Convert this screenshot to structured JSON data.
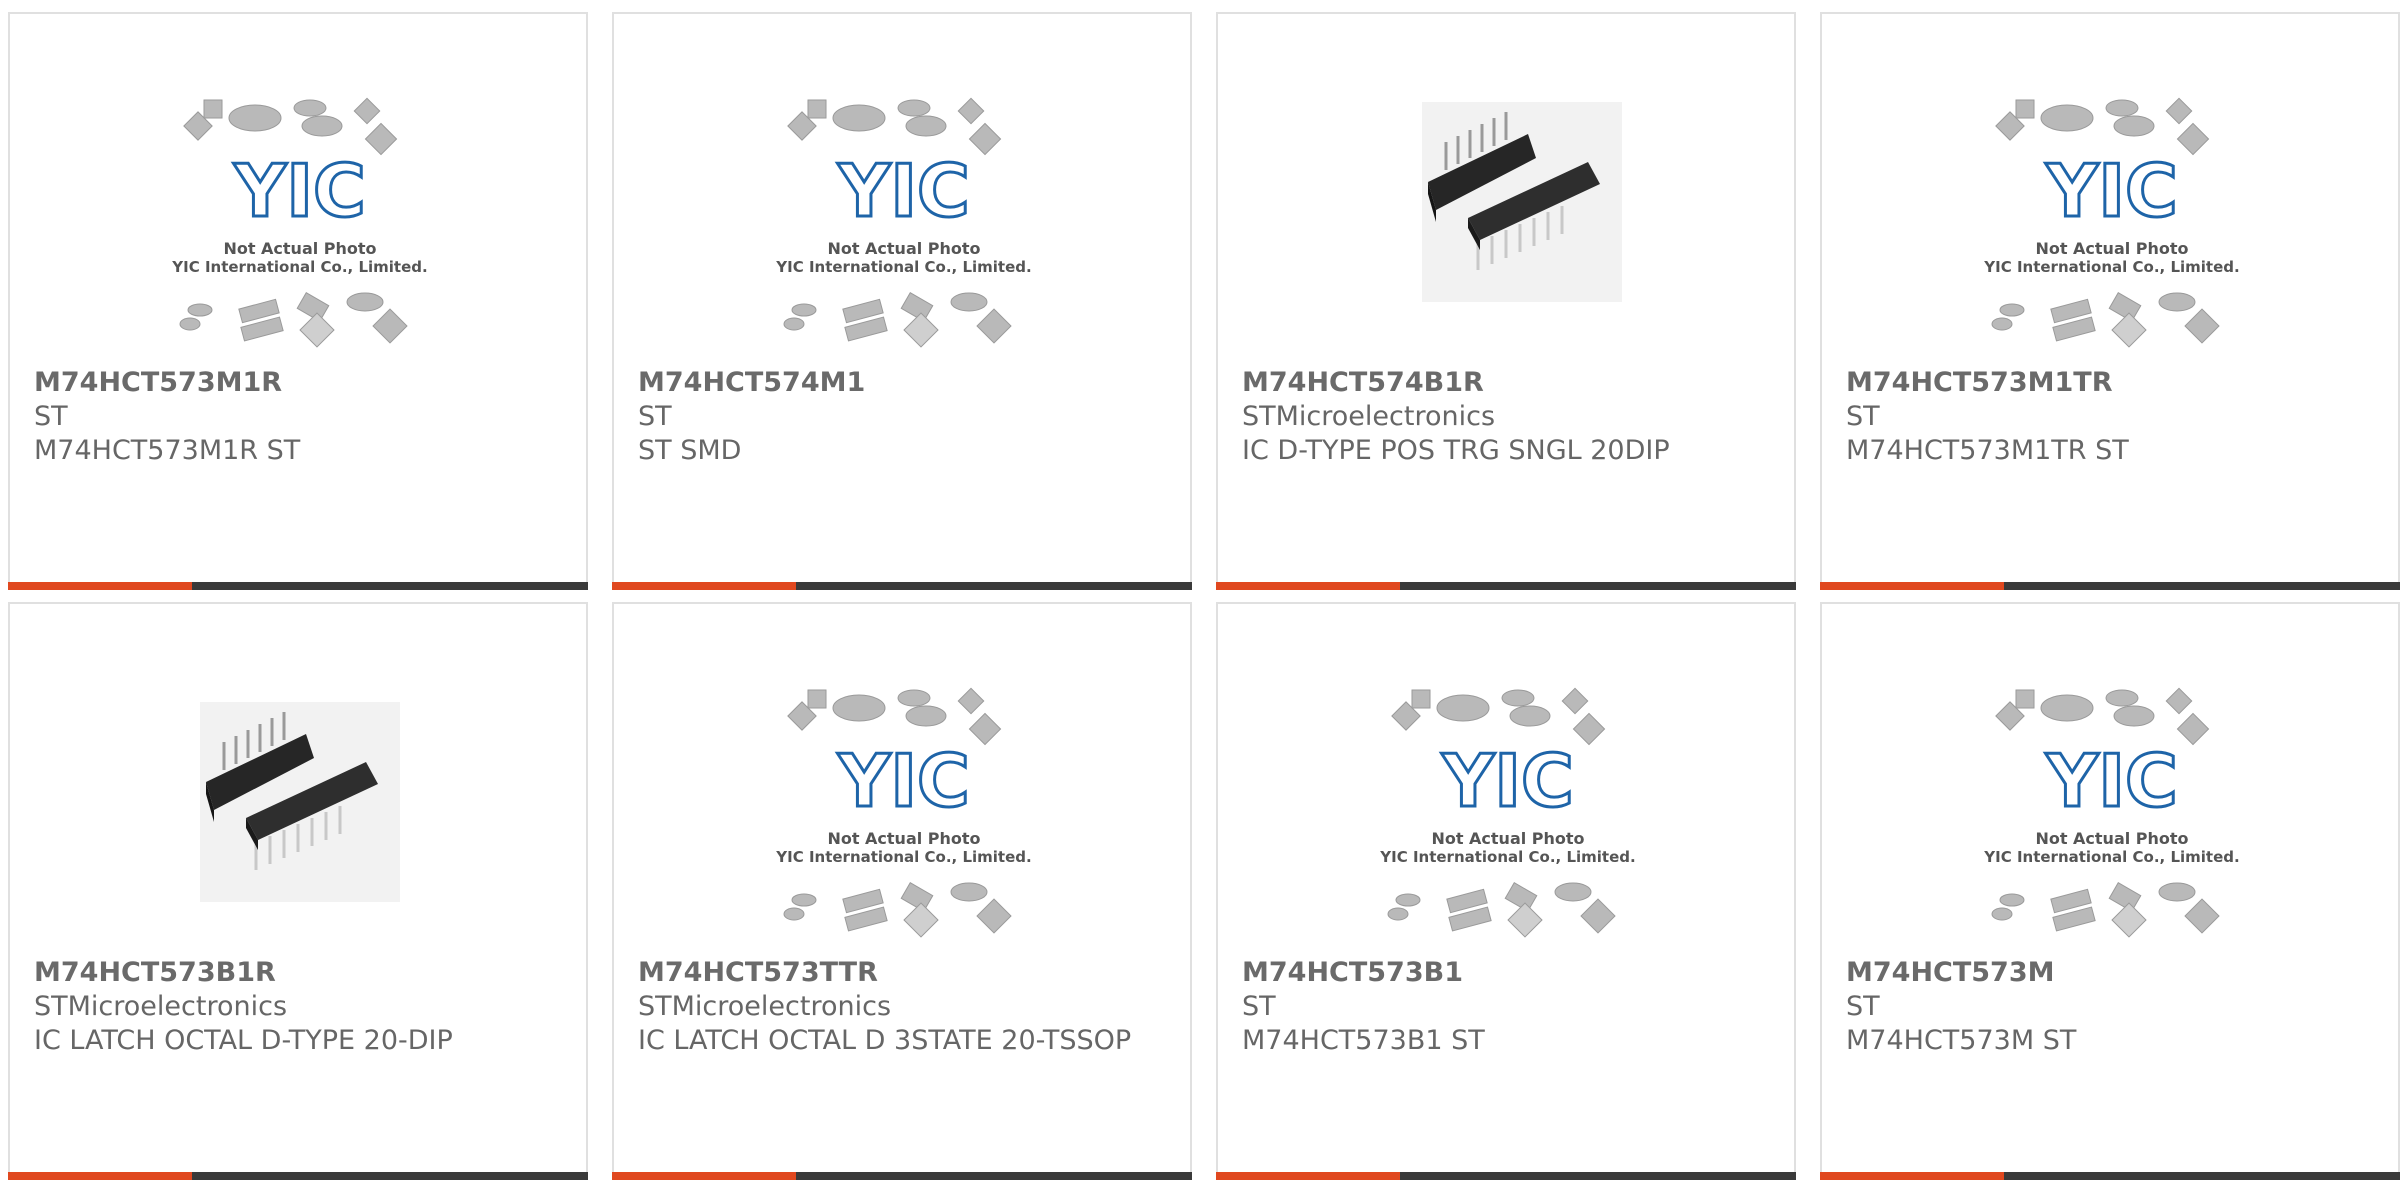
{
  "colors": {
    "accent": "#e0481f",
    "bar_dark": "#3a3a3a",
    "logo_blue": "#1e64a8",
    "text": "#666666"
  },
  "placeholder": {
    "logo_text": "YIC",
    "line1": "Not Actual Photo",
    "line2": "YIC International Co., Limited."
  },
  "products": [
    {
      "name": "M74HCT573M1R",
      "manufacturer": "ST",
      "description": "M74HCT573M1R ST",
      "image": "placeholder"
    },
    {
      "name": "M74HCT574M1",
      "manufacturer": "ST",
      "description": "ST SMD",
      "image": "placeholder"
    },
    {
      "name": "M74HCT574B1R",
      "manufacturer": "STMicroelectronics",
      "description": "IC D-TYPE POS TRG SNGL 20DIP",
      "image": "dip-chip-photo"
    },
    {
      "name": "M74HCT573M1TR",
      "manufacturer": "ST",
      "description": "M74HCT573M1TR ST",
      "image": "placeholder"
    },
    {
      "name": "M74HCT573B1R",
      "manufacturer": "STMicroelectronics",
      "description": "IC LATCH OCTAL D-TYPE 20-DIP",
      "image": "dip-chip-photo"
    },
    {
      "name": "M74HCT573TTR",
      "manufacturer": "STMicroelectronics",
      "description": "IC LATCH OCTAL D 3STATE 20-TSSOP",
      "image": "placeholder"
    },
    {
      "name": "M74HCT573B1",
      "manufacturer": "ST",
      "description": "M74HCT573B1 ST",
      "image": "placeholder"
    },
    {
      "name": "M74HCT573M",
      "manufacturer": "ST",
      "description": "M74HCT573M ST",
      "image": "placeholder"
    }
  ]
}
